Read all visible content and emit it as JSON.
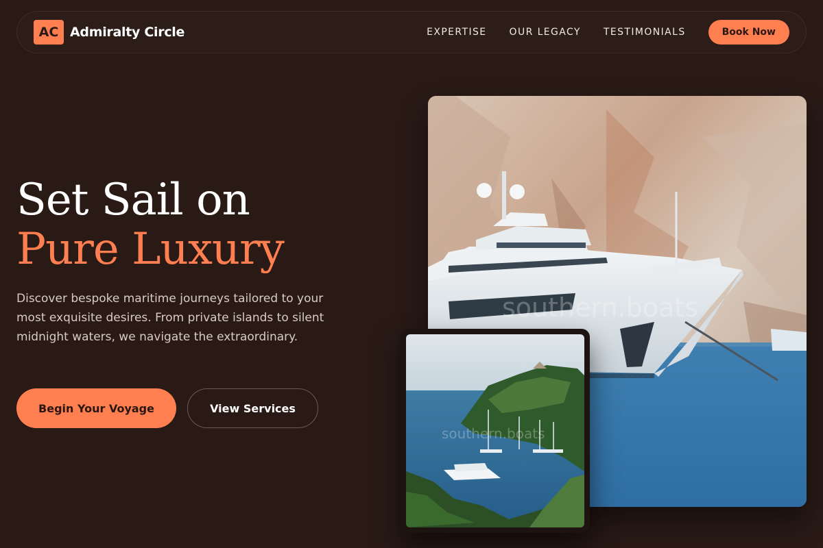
{
  "brand": {
    "logo_mark": "AC",
    "name": "Admiralty Circle",
    "accent_color": "#ff7f50",
    "background_color": "#291a16"
  },
  "nav": {
    "links": [
      {
        "label": "EXPERTISE"
      },
      {
        "label": "OUR LEGACY"
      },
      {
        "label": "TESTIMONIALS"
      }
    ],
    "cta_label": "Book Now"
  },
  "hero": {
    "title_line1": "Set Sail on",
    "title_line2": "Pure Luxury",
    "description": "Discover bespoke maritime journeys tailored to your most exquisite desires. From private islands to silent midnight waters, we navigate the extraordinary.",
    "primary_cta": "Begin Your Voyage",
    "secondary_cta": "View Services"
  },
  "images": {
    "main": {
      "subject": "superyacht anchored below limestone cliff",
      "watermark": "southern.boats"
    },
    "card": {
      "subject": "yacht in a green island cove",
      "watermark": "southern.boats"
    }
  }
}
